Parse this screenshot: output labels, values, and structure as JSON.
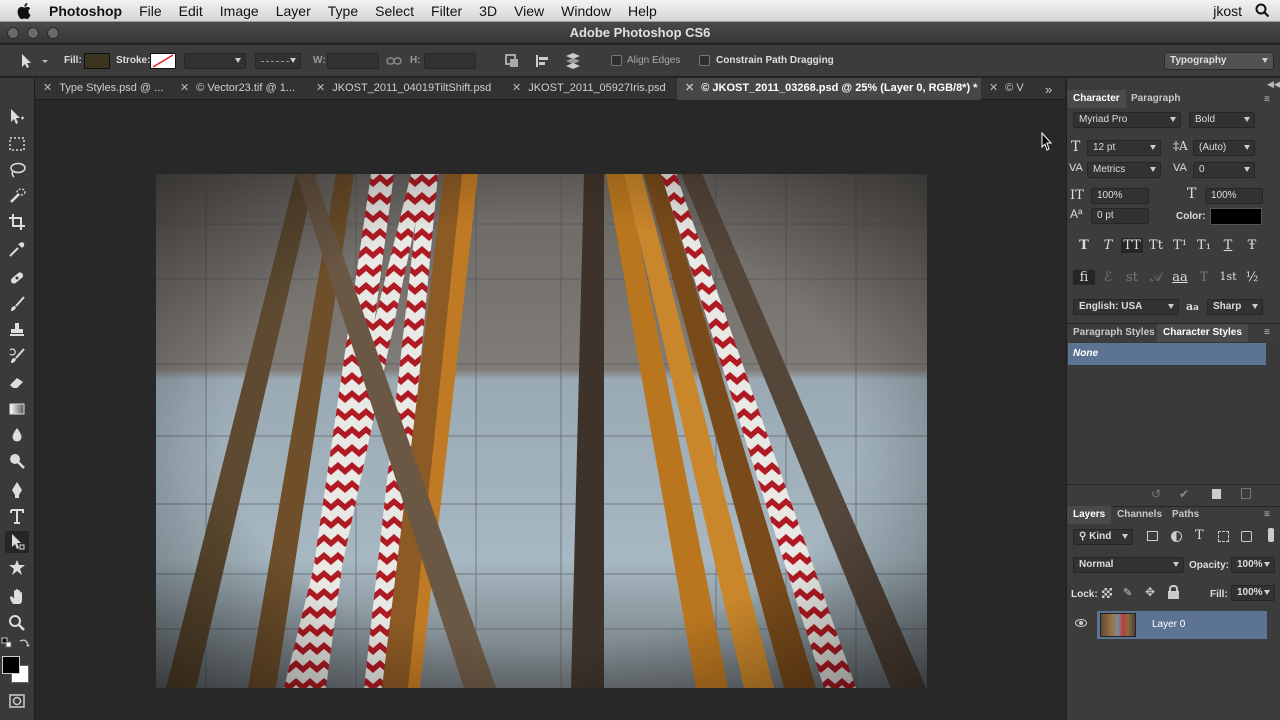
{
  "menubar": {
    "app_name": "Photoshop",
    "items": [
      "File",
      "Edit",
      "Image",
      "Layer",
      "Type",
      "Select",
      "Filter",
      "3D",
      "View",
      "Window",
      "Help"
    ],
    "user": "jkost"
  },
  "window": {
    "title": "Adobe Photoshop CS6"
  },
  "options": {
    "fill_label": "Fill:",
    "stroke_label": "Stroke:",
    "w_label": "W:",
    "h_label": "H:",
    "align_edges": "Align Edges",
    "constrain": "Constrain Path Dragging",
    "workspace": "Typography",
    "fill_color": "#3a3420"
  },
  "tabs": [
    {
      "label": "Type Styles.psd @ ..."
    },
    {
      "label": "© Vector23.tif @ 1..."
    },
    {
      "label": "JKOST_2011_04019TiltShift.psd"
    },
    {
      "label": "JKOST_2011_05927Iris.psd"
    },
    {
      "label": "© JKOST_2011_03268.psd @ 25% (Layer 0, RGB/8*) *"
    },
    {
      "label": "© V"
    }
  ],
  "character": {
    "tab_character": "Character",
    "tab_paragraph": "Paragraph",
    "font_family": "Myriad Pro",
    "font_style": "Bold",
    "size": "12 pt",
    "leading": "(Auto)",
    "kerning": "Metrics",
    "tracking": "0",
    "vscale": "100%",
    "hscale": "100%",
    "baseline": "0 pt",
    "color_label": "Color:",
    "language": "English: USA",
    "aa_label": "a",
    "antialias": "Sharp",
    "style_buttons": [
      "T",
      "T",
      "TT",
      "Tt",
      "T¹",
      "T₁",
      "T",
      "Ŧ"
    ],
    "opentype_buttons": [
      "fi",
      "ℰ",
      "st",
      "𝒜",
      "aa",
      "T",
      "1st",
      "½"
    ]
  },
  "styles_panel": {
    "tab_paragraph_styles": "Paragraph Styles",
    "tab_character_styles": "Character Styles",
    "selected": "None"
  },
  "layers": {
    "tab_layers": "Layers",
    "tab_channels": "Channels",
    "tab_paths": "Paths",
    "kind": "Kind",
    "blend": "Normal",
    "opacity_label": "Opacity:",
    "opacity": "100%",
    "lock_label": "Lock:",
    "fill_label": "Fill:",
    "fill": "100%",
    "layer_name": "Layer 0"
  }
}
